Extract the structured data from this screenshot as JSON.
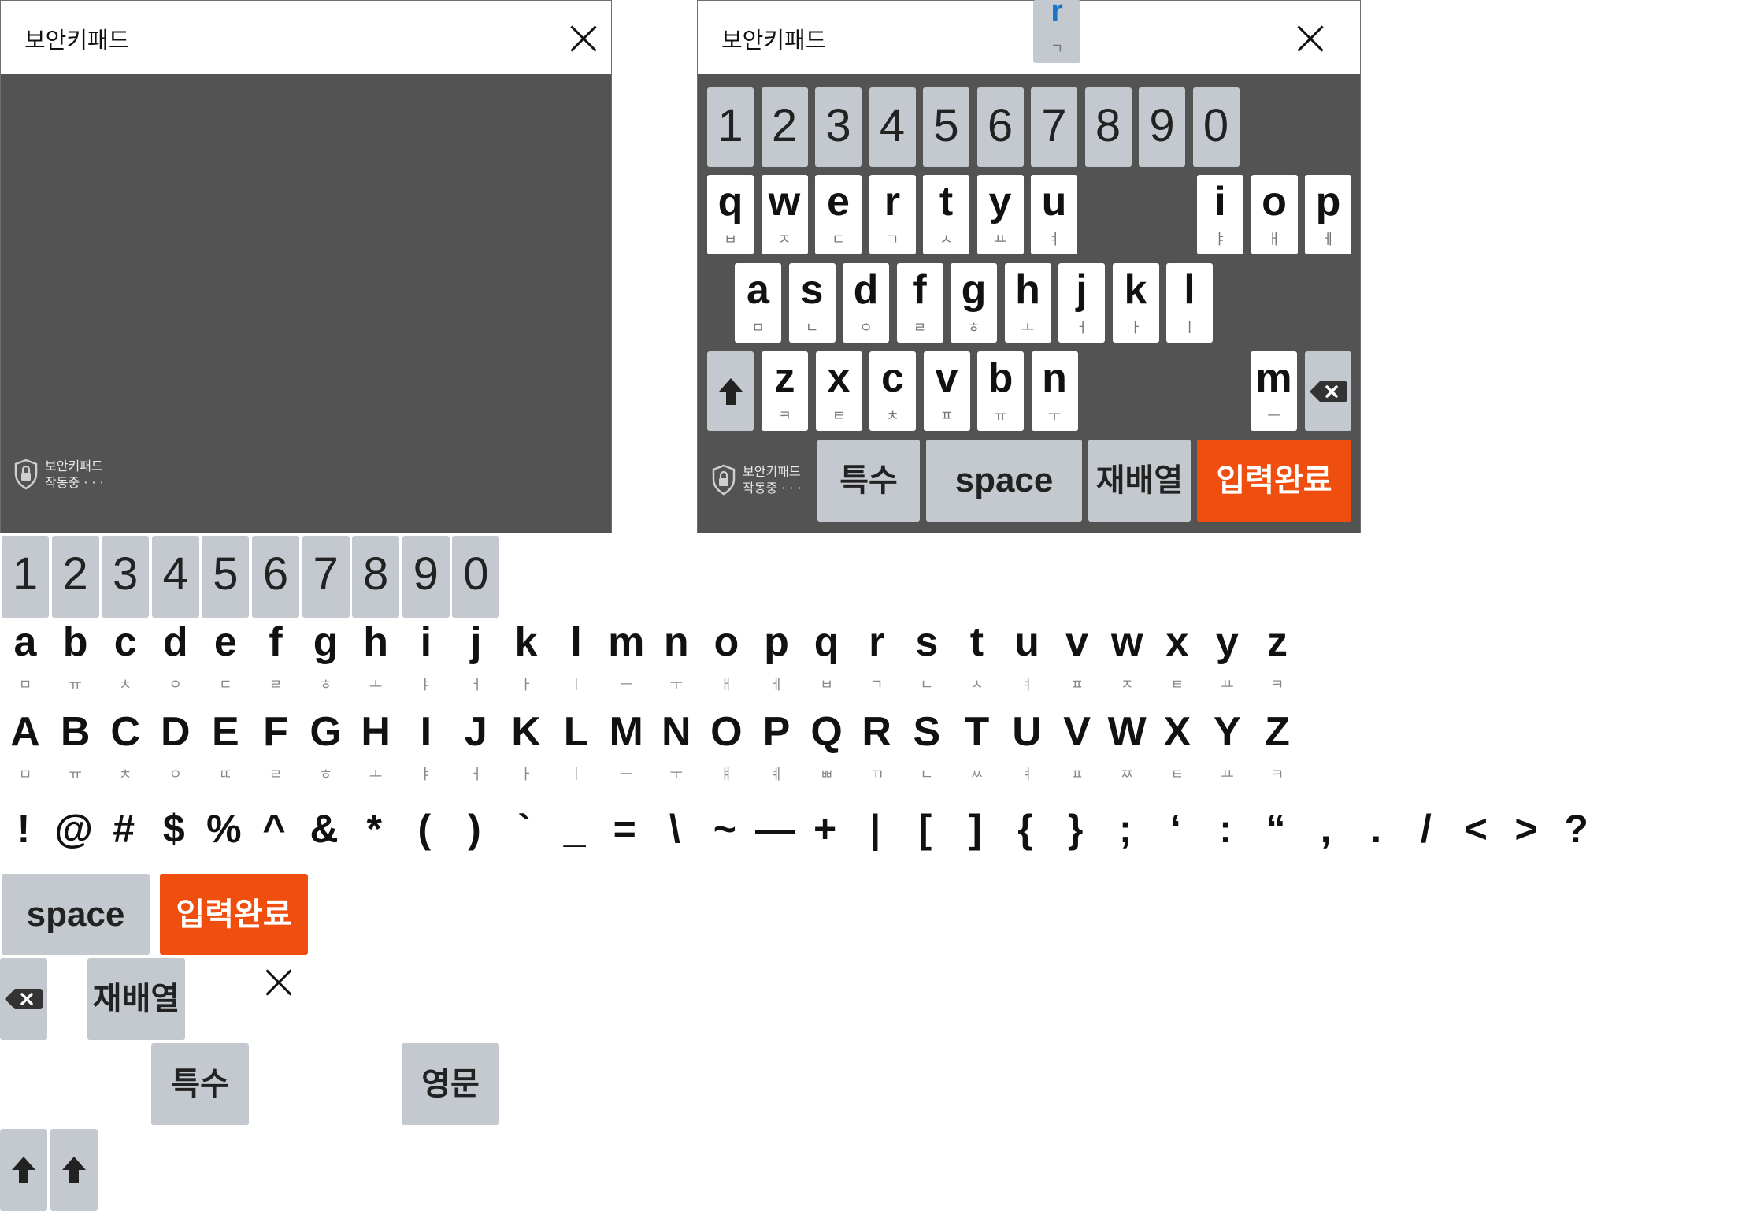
{
  "left_panel": {
    "title": "보안키패드",
    "badge_line1": "보안키패드",
    "badge_line2": "작동중 · · ·"
  },
  "right_panel": {
    "title": "보안키패드",
    "badge_line1": "보안키패드",
    "badge_line2": "작동중 · · ·",
    "popup": {
      "main": "r",
      "sub": "ㄱ"
    },
    "number_row": [
      "1",
      "2",
      "3",
      "4",
      "5",
      "6",
      "7",
      "8",
      "9",
      "0"
    ],
    "row_q_left": [
      {
        "k": "q",
        "h": "ㅂ"
      },
      {
        "k": "w",
        "h": "ㅈ"
      },
      {
        "k": "e",
        "h": "ㄷ"
      },
      {
        "k": "r",
        "h": "ㄱ"
      },
      {
        "k": "t",
        "h": "ㅅ"
      },
      {
        "k": "y",
        "h": "ㅛ"
      },
      {
        "k": "u",
        "h": "ㅕ"
      }
    ],
    "row_q_right": [
      {
        "k": "i",
        "h": "ㅑ"
      },
      {
        "k": "o",
        "h": "ㅐ"
      },
      {
        "k": "p",
        "h": "ㅔ"
      }
    ],
    "row_a": [
      {
        "k": "a",
        "h": "ㅁ"
      },
      {
        "k": "s",
        "h": "ㄴ"
      },
      {
        "k": "d",
        "h": "ㅇ"
      },
      {
        "k": "f",
        "h": "ㄹ"
      },
      {
        "k": "g",
        "h": "ㅎ"
      },
      {
        "k": "h",
        "h": "ㅗ"
      },
      {
        "k": "j",
        "h": "ㅓ"
      },
      {
        "k": "k",
        "h": "ㅏ"
      },
      {
        "k": "l",
        "h": "ㅣ"
      }
    ],
    "row_z": [
      {
        "k": "z",
        "h": "ㅋ"
      },
      {
        "k": "x",
        "h": "ㅌ"
      },
      {
        "k": "c",
        "h": "ㅊ"
      },
      {
        "k": "v",
        "h": "ㅍ"
      },
      {
        "k": "b",
        "h": "ㅠ"
      },
      {
        "k": "n",
        "h": "ㅜ"
      }
    ],
    "row_z_right": {
      "k": "m",
      "h": "ㅡ"
    },
    "special_label": "특수",
    "space_label": "space",
    "shuffle_label": "재배열",
    "done_label": "입력완료"
  },
  "sprites": {
    "numbers": [
      "1",
      "2",
      "3",
      "4",
      "5",
      "6",
      "7",
      "8",
      "9",
      "0"
    ],
    "lower": [
      {
        "k": "a",
        "h": "ㅁ"
      },
      {
        "k": "b",
        "h": "ㅠ"
      },
      {
        "k": "c",
        "h": "ㅊ"
      },
      {
        "k": "d",
        "h": "ㅇ"
      },
      {
        "k": "e",
        "h": "ㄷ"
      },
      {
        "k": "f",
        "h": "ㄹ"
      },
      {
        "k": "g",
        "h": "ㅎ"
      },
      {
        "k": "h",
        "h": "ㅗ"
      },
      {
        "k": "i",
        "h": "ㅑ"
      },
      {
        "k": "j",
        "h": "ㅓ"
      },
      {
        "k": "k",
        "h": "ㅏ"
      },
      {
        "k": "l",
        "h": "ㅣ"
      },
      {
        "k": "m",
        "h": "ㅡ"
      },
      {
        "k": "n",
        "h": "ㅜ"
      },
      {
        "k": "o",
        "h": "ㅐ"
      },
      {
        "k": "p",
        "h": "ㅔ"
      },
      {
        "k": "q",
        "h": "ㅂ"
      },
      {
        "k": "r",
        "h": "ㄱ"
      },
      {
        "k": "s",
        "h": "ㄴ"
      },
      {
        "k": "t",
        "h": "ㅅ"
      },
      {
        "k": "u",
        "h": "ㅕ"
      },
      {
        "k": "v",
        "h": "ㅍ"
      },
      {
        "k": "w",
        "h": "ㅈ"
      },
      {
        "k": "x",
        "h": "ㅌ"
      },
      {
        "k": "y",
        "h": "ㅛ"
      },
      {
        "k": "z",
        "h": "ㅋ"
      }
    ],
    "upper": [
      {
        "k": "A",
        "h": "ㅁ"
      },
      {
        "k": "B",
        "h": "ㅠ"
      },
      {
        "k": "C",
        "h": "ㅊ"
      },
      {
        "k": "D",
        "h": "ㅇ"
      },
      {
        "k": "E",
        "h": "ㄸ"
      },
      {
        "k": "F",
        "h": "ㄹ"
      },
      {
        "k": "G",
        "h": "ㅎ"
      },
      {
        "k": "H",
        "h": "ㅗ"
      },
      {
        "k": "I",
        "h": "ㅑ"
      },
      {
        "k": "J",
        "h": "ㅓ"
      },
      {
        "k": "K",
        "h": "ㅏ"
      },
      {
        "k": "L",
        "h": "ㅣ"
      },
      {
        "k": "M",
        "h": "ㅡ"
      },
      {
        "k": "N",
        "h": "ㅜ"
      },
      {
        "k": "O",
        "h": "ㅒ"
      },
      {
        "k": "P",
        "h": "ㅖ"
      },
      {
        "k": "Q",
        "h": "ㅃ"
      },
      {
        "k": "R",
        "h": "ㄲ"
      },
      {
        "k": "S",
        "h": "ㄴ"
      },
      {
        "k": "T",
        "h": "ㅆ"
      },
      {
        "k": "U",
        "h": "ㅕ"
      },
      {
        "k": "V",
        "h": "ㅍ"
      },
      {
        "k": "W",
        "h": "ㅉ"
      },
      {
        "k": "X",
        "h": "ㅌ"
      },
      {
        "k": "Y",
        "h": "ㅛ"
      },
      {
        "k": "Z",
        "h": "ㅋ"
      }
    ],
    "symbols": [
      "!",
      "@",
      "#",
      "$",
      "%",
      "^",
      "&",
      "*",
      "(",
      ")",
      "`",
      "_",
      "=",
      "\\",
      "~",
      "—",
      "+",
      "|",
      "[",
      "]",
      "{",
      "}",
      ";",
      "‘",
      ":",
      "“",
      ",",
      ".",
      "/",
      "<",
      ">",
      "?"
    ],
    "space_label": "space",
    "done_label": "입력완료",
    "shuffle_label": "재배열",
    "special_label": "특수",
    "english_label": "영문"
  },
  "colors": {
    "panel_bg": "#535353",
    "key_white": "#ffffff",
    "key_gray": "#c3c9cf",
    "accent_orange": "#f04e0f",
    "popup_accent": "#1a73c9"
  }
}
